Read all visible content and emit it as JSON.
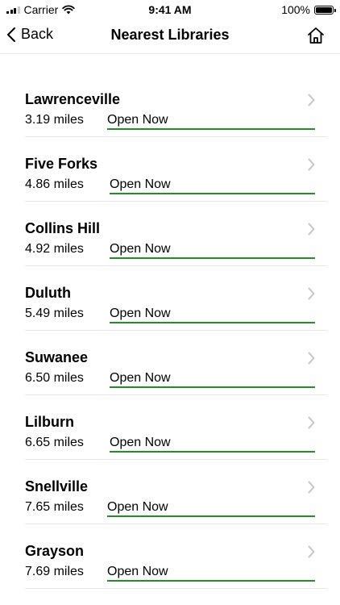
{
  "status_bar": {
    "carrier": "Carrier",
    "time": "9:41 AM",
    "battery": "100%"
  },
  "nav": {
    "back_label": "Back",
    "title": "Nearest Libraries"
  },
  "libraries": [
    {
      "name": "Lawrenceville",
      "distance": "3.19 miles",
      "status": "Open Now"
    },
    {
      "name": "Five Forks",
      "distance": "4.86 miles",
      "status": "Open Now"
    },
    {
      "name": "Collins Hill",
      "distance": "4.92 miles",
      "status": "Open Now"
    },
    {
      "name": "Duluth",
      "distance": "5.49 miles",
      "status": "Open Now"
    },
    {
      "name": "Suwanee",
      "distance": "6.50 miles",
      "status": "Open Now"
    },
    {
      "name": "Lilburn",
      "distance": "6.65 miles",
      "status": "Open Now"
    },
    {
      "name": "Snellville",
      "distance": "7.65 miles",
      "status": "Open Now"
    },
    {
      "name": "Grayson",
      "distance": "7.69 miles",
      "status": "Open Now"
    }
  ],
  "colors": {
    "open_underline": "#2a8a2a",
    "chevron": "#c4c4c8",
    "divider": "#e6e6e6"
  },
  "icons": {
    "back": "chevron-left-icon",
    "home": "home-icon",
    "row": "chevron-right-icon"
  }
}
